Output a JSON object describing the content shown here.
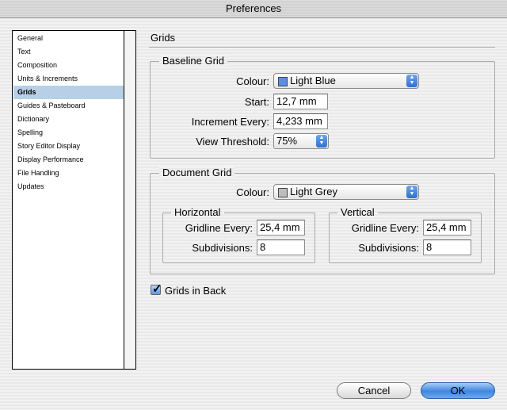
{
  "window": {
    "title": "Preferences"
  },
  "sidebar": {
    "items": [
      {
        "label": "General",
        "selected": false
      },
      {
        "label": "Text",
        "selected": false
      },
      {
        "label": "Composition",
        "selected": false
      },
      {
        "label": "Units & Increments",
        "selected": false
      },
      {
        "label": "Grids",
        "selected": true
      },
      {
        "label": "Guides & Pasteboard",
        "selected": false
      },
      {
        "label": "Dictionary",
        "selected": false
      },
      {
        "label": "Spelling",
        "selected": false
      },
      {
        "label": "Story Editor Display",
        "selected": false
      },
      {
        "label": "Display Performance",
        "selected": false
      },
      {
        "label": "File Handling",
        "selected": false
      },
      {
        "label": "Updates",
        "selected": false
      }
    ]
  },
  "panel": {
    "title": "Grids"
  },
  "baseline_grid": {
    "label": "Baseline Grid",
    "colour_label": "Colour:",
    "colour_value": "Light Blue",
    "colour_swatch": "#5b8fe6",
    "start_label": "Start:",
    "start_value": "12,7 mm",
    "increment_label": "Increment Every:",
    "increment_value": "4,233 mm",
    "threshold_label": "View Threshold:",
    "threshold_value": "75%"
  },
  "document_grid": {
    "label": "Document Grid",
    "colour_label": "Colour:",
    "colour_value": "Light Grey",
    "colour_swatch": "#bdbdbd",
    "horizontal": {
      "label": "Horizontal",
      "gridline_label": "Gridline Every:",
      "gridline_value": "25,4 mm",
      "subdivisions_label": "Subdivisions:",
      "subdivisions_value": "8"
    },
    "vertical": {
      "label": "Vertical",
      "gridline_label": "Gridline Every:",
      "gridline_value": "25,4 mm",
      "subdivisions_label": "Subdivisions:",
      "subdivisions_value": "8"
    }
  },
  "grids_in_back": {
    "label": "Grids in Back",
    "checked": true
  },
  "buttons": {
    "cancel": "Cancel",
    "ok": "OK"
  }
}
